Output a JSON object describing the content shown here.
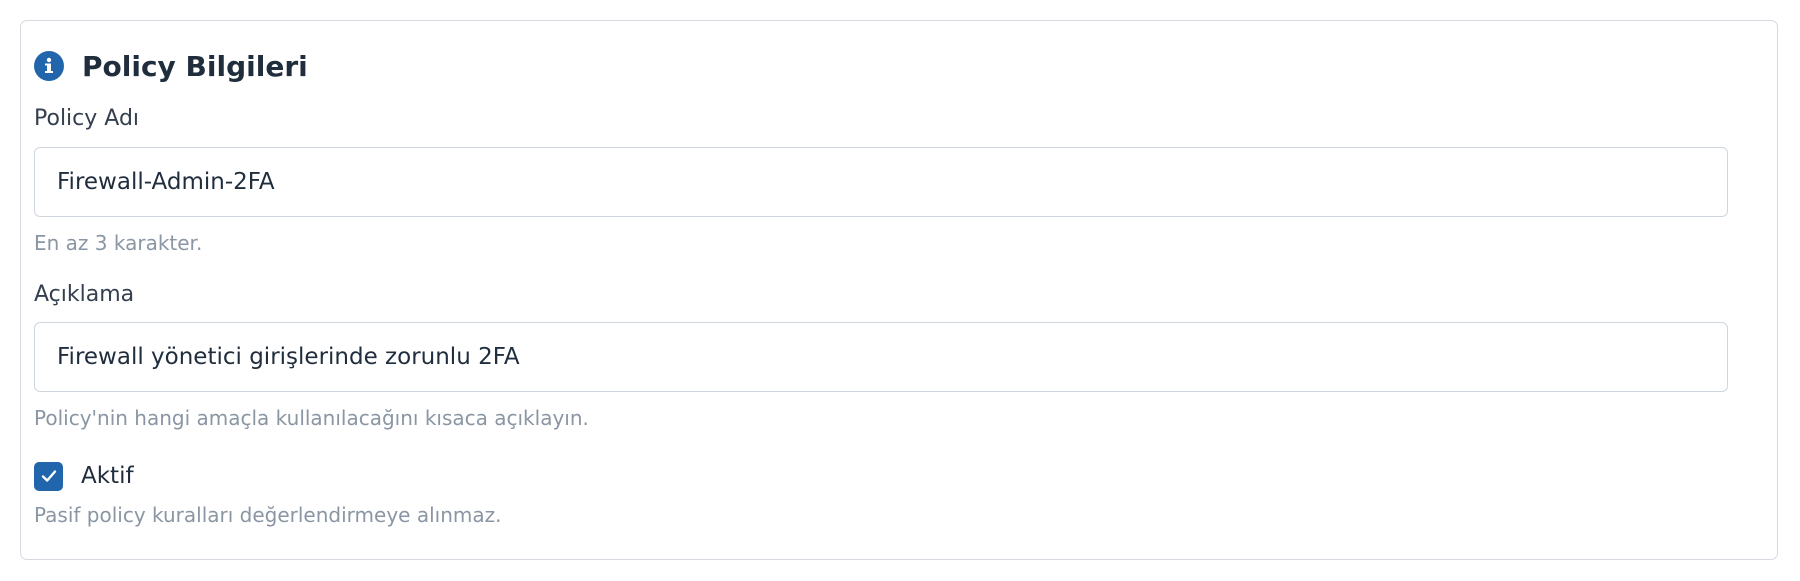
{
  "section": {
    "title": "Policy Bilgileri",
    "icon": "info-icon",
    "accent_color": "#2166ac"
  },
  "policy_name": {
    "label": "Policy Adı",
    "value": "Firewall-Admin-2FA",
    "help": "En az 3 karakter."
  },
  "description": {
    "label": "Açıklama",
    "value": "Firewall yönetici girişlerinde zorunlu 2FA",
    "help": "Policy'nin hangi amaçla kullanılacağını kısaca açıklayın."
  },
  "active": {
    "label": "Aktif",
    "checked": true,
    "help": "Pasif policy kuralları değerlendirmeye alınmaz."
  }
}
